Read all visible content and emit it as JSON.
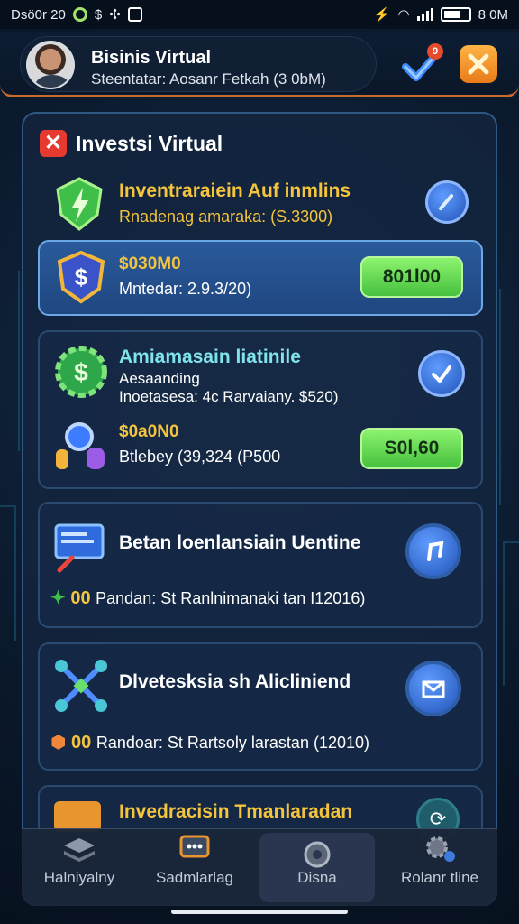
{
  "status_bar": {
    "time": "Dsö0r 20",
    "battery_text": "8 0M"
  },
  "header": {
    "profile_name": "Bisinis Virtual",
    "profile_sub": "Steentatar: Aosanr Fetkah (3 0bM)",
    "notification_count": "9"
  },
  "panel": {
    "title": "Investsi Virtual"
  },
  "cards": [
    {
      "title": "Inventraraiein Auf inmlins",
      "subtitle": "Rnadenag amaraka: (S.3300)"
    },
    {
      "amount": "$030M0",
      "detail": "Mntedar: 2.9.3/20)",
      "button": "801l00"
    },
    {
      "title": "Amiamasain liatinile",
      "line1": "Aesaanding",
      "line2": "Inoetasesa: 4c Rarvaiany. $520)",
      "amount": "$0a0N0",
      "detail": "Btlebey (39,324 (P500",
      "button": "S0l,60"
    },
    {
      "title": "Betan loenlansiain Uentine",
      "prefix": "00",
      "detail": "Pandan: St Ranlnimanaki tan I12016)"
    },
    {
      "title": "Dlvetesksia sh Alicliniend",
      "prefix": "00",
      "detail": "Randoar: St Rartsoly larastan (12010)"
    },
    {
      "title": "Invedracisin Tmanlaradan"
    }
  ],
  "bottom_nav": [
    {
      "label": "Halniyalny",
      "icon": "stack-icon"
    },
    {
      "label": "Sadmlarlag",
      "icon": "chat-icon"
    },
    {
      "label": "Disna",
      "icon": "lock-icon"
    },
    {
      "label": "Rolanr tline",
      "icon": "gears-icon"
    }
  ],
  "colors": {
    "accent_gold": "#f5c43d",
    "accent_cyan": "#7fe3ea",
    "button_green": "#46c13f",
    "header_border": "#c9692d"
  }
}
